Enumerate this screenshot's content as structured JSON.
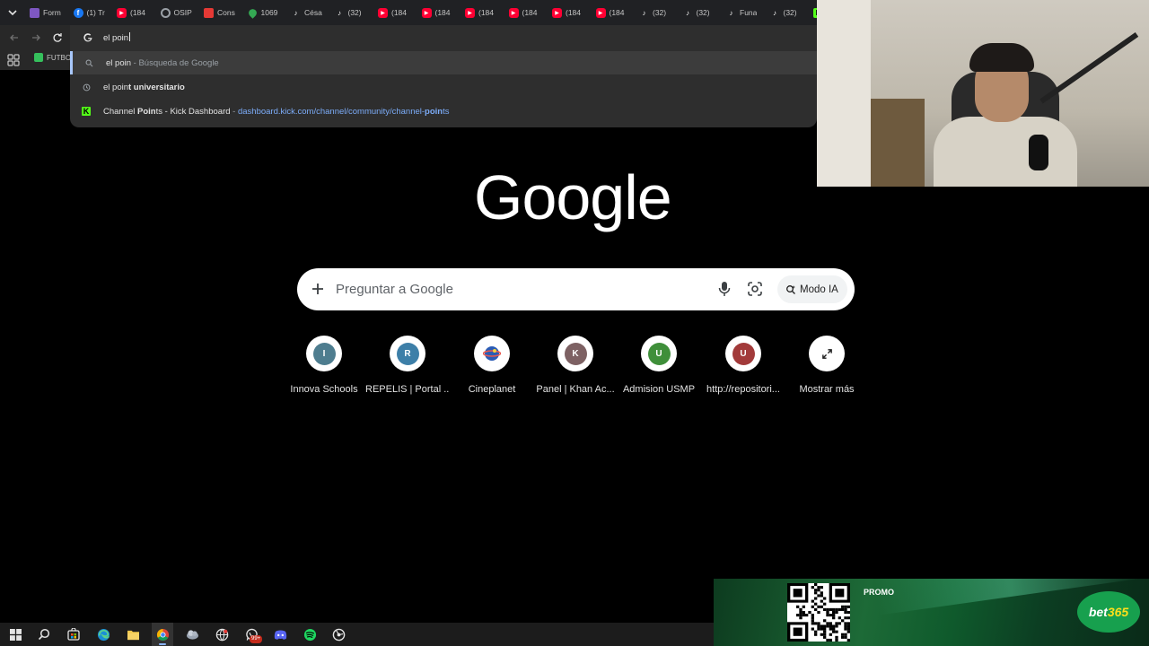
{
  "tabs": [
    {
      "title": "Form",
      "icon": "forms-icon",
      "color": "#7e57c2"
    },
    {
      "title": "(1) Tr",
      "icon": "facebook-icon",
      "color": "#1877f2"
    },
    {
      "title": "(184",
      "icon": "youtube-icon",
      "color": "#ff0033"
    },
    {
      "title": "OSIP",
      "icon": "osiptel-icon",
      "color": "#9aa0a6"
    },
    {
      "title": "Cons",
      "icon": "document-icon",
      "color": "#e53935"
    },
    {
      "title": "1069",
      "icon": "maps-pin-icon",
      "color": "#34a853"
    },
    {
      "title": "Césa",
      "icon": "tiktok-icon",
      "color": "#ffffff"
    },
    {
      "title": "(32)",
      "icon": "tiktok-icon",
      "color": "#ffffff"
    },
    {
      "title": "(184",
      "icon": "youtube-icon",
      "color": "#ff0033"
    },
    {
      "title": "(184",
      "icon": "youtube-icon",
      "color": "#ff0033"
    },
    {
      "title": "(184",
      "icon": "youtube-icon",
      "color": "#ff0033"
    },
    {
      "title": "(184",
      "icon": "youtube-icon",
      "color": "#ff0033"
    },
    {
      "title": "(184",
      "icon": "youtube-icon",
      "color": "#ff0033"
    },
    {
      "title": "(184",
      "icon": "youtube-icon",
      "color": "#ff0033"
    },
    {
      "title": "(32)",
      "icon": "tiktok-icon",
      "color": "#ffffff"
    },
    {
      "title": "(32)",
      "icon": "tiktok-icon",
      "color": "#ffffff"
    },
    {
      "title": "Funa",
      "icon": "tiktok-icon",
      "color": "#ffffff"
    },
    {
      "title": "(32)",
      "icon": "tiktok-icon",
      "color": "#ffffff"
    },
    {
      "title": "",
      "icon": "kick-icon",
      "color": "#53fc18"
    }
  ],
  "bookmarks": {
    "futbol": "FUTBOL"
  },
  "omnibox": {
    "query": "el poin",
    "suggestions": [
      {
        "icon": "search-icon",
        "match": "el poin",
        "rest": "",
        "sep": " - ",
        "desc": "Búsqueda de Google",
        "selected": true
      },
      {
        "icon": "history-icon",
        "match": "el poin",
        "rest": "t universitario",
        "sep": "",
        "desc": "",
        "selected": false
      },
      {
        "icon": "kick-icon",
        "pre": "Channel ",
        "match": "Poin",
        "rest": "ts - Kick Dashboard",
        "sep": " - ",
        "url_pre": "dashboard.kick.com/channel/community/channel-",
        "url_match": "poin",
        "url_rest": "ts",
        "selected": false
      }
    ]
  },
  "ntp": {
    "logo": "Google",
    "placeholder": "Preguntar a Google",
    "ai_mode": "Modo IA",
    "shortcuts": [
      {
        "letter": "I",
        "label": "Innova Schools",
        "color": "#4e7d8f"
      },
      {
        "letter": "R",
        "label": "REPELIS | Portal ...",
        "color": "#3d7fa8"
      },
      {
        "letter": "",
        "label": "Cineplanet",
        "color": "#3f6fb5"
      },
      {
        "letter": "K",
        "label": "Panel | Khan Ac...",
        "color": "#7d6163"
      },
      {
        "letter": "U",
        "label": "Admision USMP",
        "color": "#3f8f3a"
      },
      {
        "letter": "U",
        "label": "http://repositori...",
        "color": "#a23a3a"
      },
      {
        "letter": "",
        "label": "Mostrar más",
        "color": "#ffffff"
      }
    ]
  },
  "promo": {
    "label": "PROMO",
    "brand_a": "bet",
    "brand_b": "365"
  },
  "taskbar": {
    "whatsapp_badge": "99+"
  }
}
